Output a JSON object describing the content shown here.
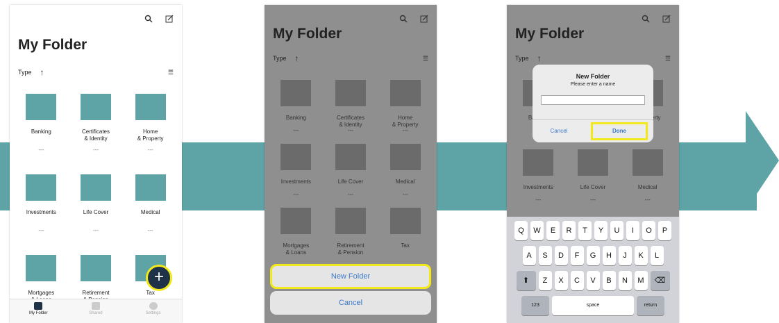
{
  "colors": {
    "teal": "#5ea4a6",
    "highlight": "#f2e91a",
    "folder": "#5ea4a6",
    "folder_dim": "#6b6b6b"
  },
  "screen1": {
    "title": "My Folder",
    "sort_label": "Type",
    "folders": [
      {
        "name": "Banking",
        "count": "---"
      },
      {
        "name": "Certificates\n& Identity",
        "count": "---"
      },
      {
        "name": "Home\n& Property",
        "count": "---"
      },
      {
        "name": "Investments",
        "count": "---"
      },
      {
        "name": "Life Cover",
        "count": "---"
      },
      {
        "name": "Medical",
        "count": "---"
      },
      {
        "name": "Mortgages\n& Loans",
        "count": ""
      },
      {
        "name": "Retirement\n& Pension",
        "count": ""
      },
      {
        "name": "Tax",
        "count": ""
      }
    ],
    "tabs": [
      "My Folder",
      "Shared",
      "Settings"
    ],
    "fab_label": "+"
  },
  "screen2": {
    "title": "My Folder",
    "sort_label": "Type",
    "folders": [
      {
        "name": "Banking",
        "count": "---"
      },
      {
        "name": "Certificates\n& Identity",
        "count": "---"
      },
      {
        "name": "Home\n& Property",
        "count": "---"
      },
      {
        "name": "Investments",
        "count": "---"
      },
      {
        "name": "Life Cover",
        "count": "---"
      },
      {
        "name": "Medical",
        "count": "---"
      },
      {
        "name": "Mortgages\n& Loans",
        "count": ""
      },
      {
        "name": "Retirement\n& Pension",
        "count": ""
      },
      {
        "name": "Tax",
        "count": ""
      }
    ],
    "new_folder": "New Folder",
    "cancel": "Cancel"
  },
  "screen3": {
    "title": "My Folder",
    "sort_label": "Type",
    "folders": [
      {
        "name": "Banking",
        "count": ""
      },
      {
        "name": "",
        "count": ""
      },
      {
        "name": "& Property",
        "count": ""
      },
      {
        "name": "Investments",
        "count": "---"
      },
      {
        "name": "Life Cover",
        "count": "---"
      },
      {
        "name": "Medical",
        "count": "---"
      }
    ],
    "dialog": {
      "title": "New Folder",
      "message": "Please enter a name",
      "cancel": "Cancel",
      "done": "Done"
    },
    "keyboard": {
      "row1": [
        "Q",
        "W",
        "E",
        "R",
        "T",
        "Y",
        "U",
        "I",
        "O",
        "P"
      ],
      "row2": [
        "A",
        "S",
        "D",
        "F",
        "G",
        "H",
        "J",
        "K",
        "L"
      ],
      "row3": [
        "Z",
        "X",
        "C",
        "V",
        "B",
        "N",
        "M"
      ],
      "numbers": "123",
      "space": "space",
      "return": "return"
    }
  }
}
